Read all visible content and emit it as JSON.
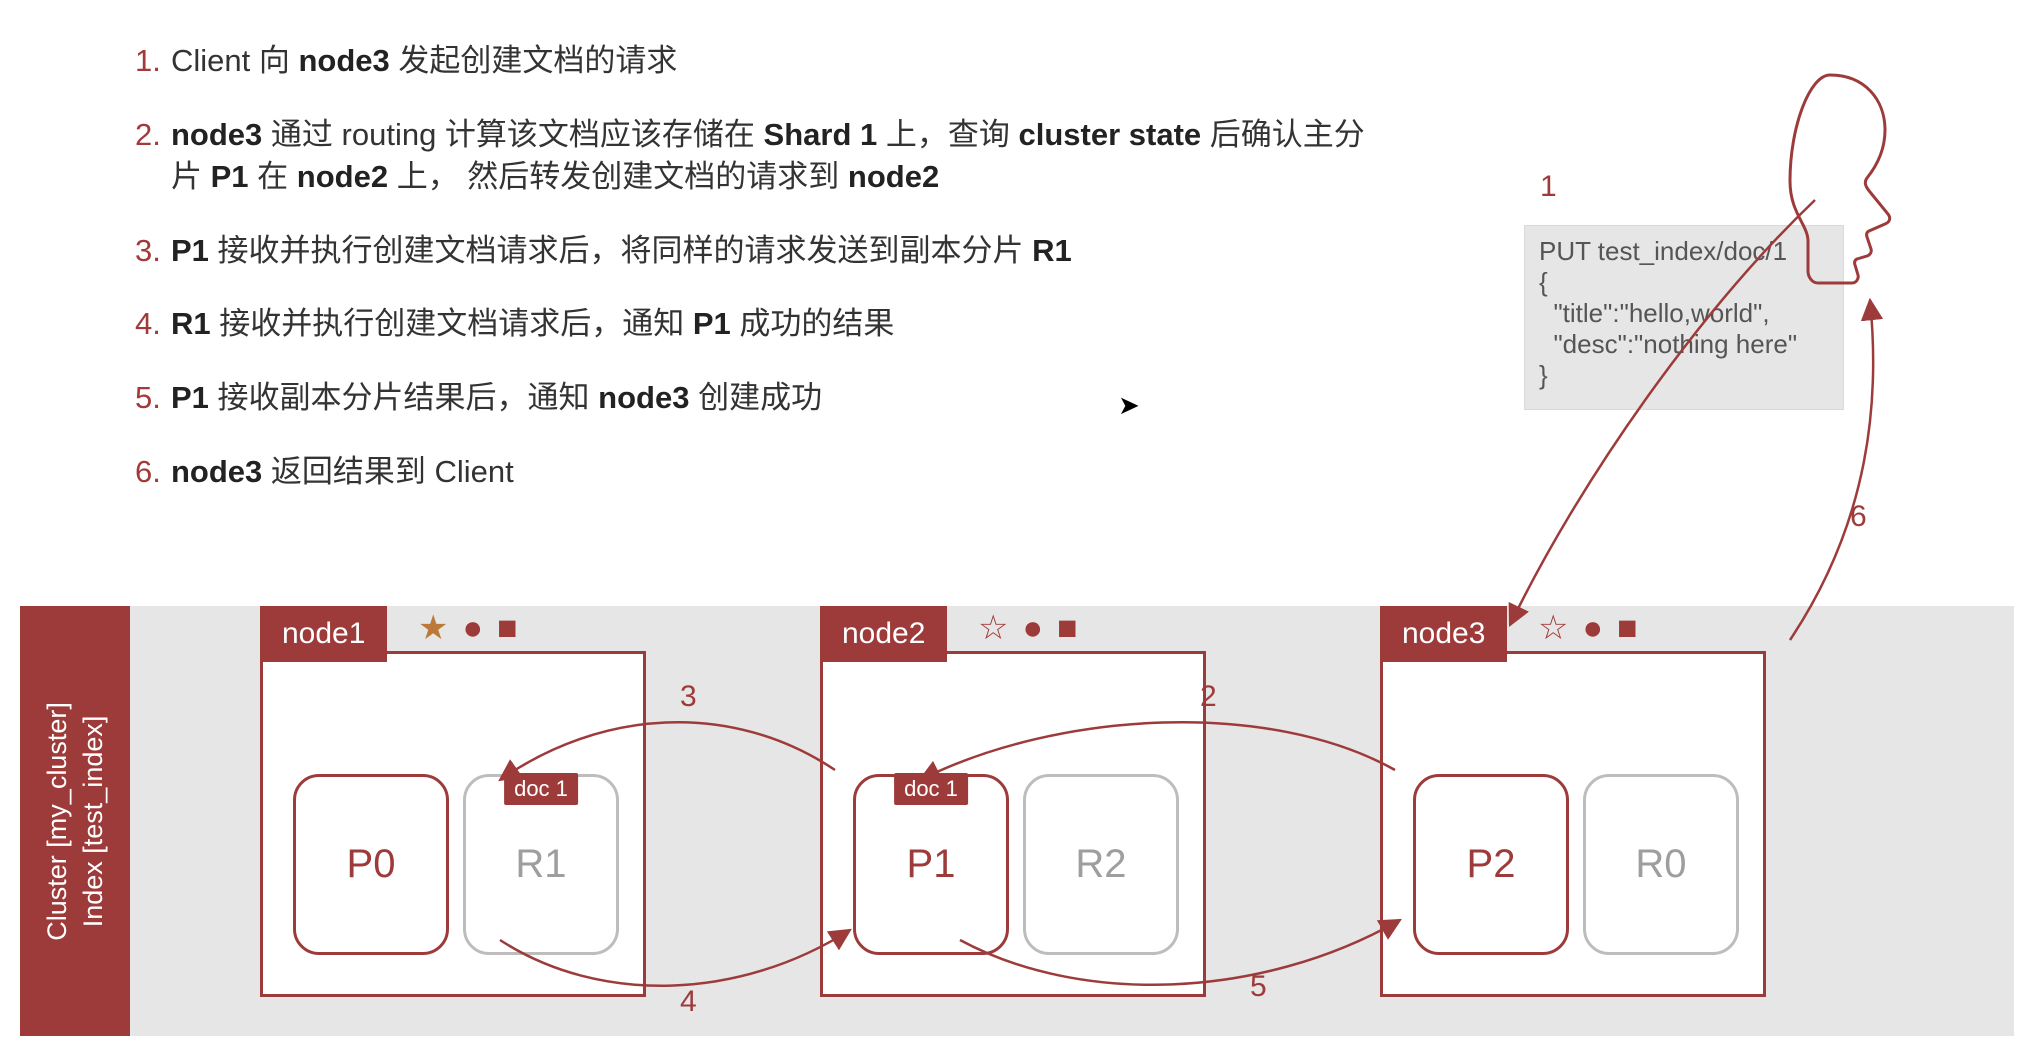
{
  "steps": [
    {
      "n": "1.",
      "segs": [
        {
          "t": "Client 向 "
        },
        {
          "b": "node3"
        },
        {
          "t": " 发起创建文档的请求"
        }
      ]
    },
    {
      "n": "2.",
      "segs": [
        {
          "b": "node3"
        },
        {
          "t": " 通过 routing 计算该文档应该存储在 "
        },
        {
          "b": "Shard 1"
        },
        {
          "t": " 上，查询 "
        },
        {
          "b": "cluster state"
        },
        {
          "t": " 后确认主分片 "
        },
        {
          "b": "P1"
        },
        {
          "t": " 在 "
        },
        {
          "b": "node2"
        },
        {
          "t": " 上， 然后转发创建文档的请求到 "
        },
        {
          "b": "node2"
        }
      ]
    },
    {
      "n": "3.",
      "segs": [
        {
          "b": "P1"
        },
        {
          "t": " 接收并执行创建文档请求后，将同样的请求发送到副本分片 "
        },
        {
          "b": "R1"
        }
      ]
    },
    {
      "n": "4.",
      "segs": [
        {
          "b": "R1"
        },
        {
          "t": " 接收并执行创建文档请求后，通知 "
        },
        {
          "b": "P1"
        },
        {
          "t": " 成功的结果"
        }
      ]
    },
    {
      "n": "5.",
      "segs": [
        {
          "b": "P1"
        },
        {
          "t": " 接收副本分片结果后，通知 "
        },
        {
          "b": "node3"
        },
        {
          "t": " 创建成功"
        }
      ]
    },
    {
      "n": "6.",
      "segs": [
        {
          "b": "node3"
        },
        {
          "t": " 返回结果到 Client"
        }
      ]
    }
  ],
  "code": {
    "l1": "PUT test_index/doc/1",
    "l2": "{",
    "l3": "  \"title\":\"hello,world\",",
    "l4": "  \"desc\":\"nothing here\"",
    "l5": "}"
  },
  "cluster": {
    "label_line1": "Cluster [my_cluster]",
    "label_line2": "Index [test_index]",
    "nodes": [
      {
        "name": "node1",
        "master": true,
        "shards": [
          {
            "id": "P0",
            "kind": "primary"
          },
          {
            "id": "R1",
            "kind": "replica",
            "doc": "doc 1"
          }
        ]
      },
      {
        "name": "node2",
        "master": false,
        "shards": [
          {
            "id": "P1",
            "kind": "primary",
            "doc": "doc 1"
          },
          {
            "id": "R2",
            "kind": "replica"
          }
        ]
      },
      {
        "name": "node3",
        "master": false,
        "shards": [
          {
            "id": "P2",
            "kind": "primary"
          },
          {
            "id": "R0",
            "kind": "replica"
          }
        ]
      }
    ]
  },
  "arrows": {
    "a1": "1",
    "a2": "2",
    "a3": "3",
    "a4": "4",
    "a5": "5",
    "a6": "6"
  },
  "icons": {
    "star_filled": "★",
    "star_outline": "☆",
    "circle": "●",
    "square": "■"
  }
}
